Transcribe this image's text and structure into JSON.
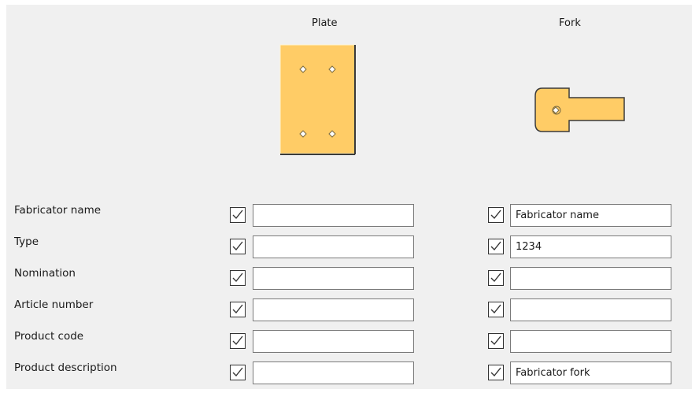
{
  "columns": {
    "plate": {
      "title": "Plate"
    },
    "fork": {
      "title": "Fork"
    }
  },
  "rows": [
    {
      "label": "Fabricator name",
      "plate": {
        "checked": true,
        "value": ""
      },
      "fork": {
        "checked": true,
        "value": "Fabricator name"
      }
    },
    {
      "label": "Type",
      "plate": {
        "checked": true,
        "value": ""
      },
      "fork": {
        "checked": true,
        "value": "1234"
      }
    },
    {
      "label": "Nomination",
      "plate": {
        "checked": true,
        "value": ""
      },
      "fork": {
        "checked": true,
        "value": ""
      }
    },
    {
      "label": "Article number",
      "plate": {
        "checked": true,
        "value": ""
      },
      "fork": {
        "checked": true,
        "value": ""
      }
    },
    {
      "label": "Product code",
      "plate": {
        "checked": true,
        "value": ""
      },
      "fork": {
        "checked": true,
        "value": ""
      }
    },
    {
      "label": "Product description",
      "plate": {
        "checked": true,
        "value": ""
      },
      "fork": {
        "checked": true,
        "value": "Fabricator fork"
      }
    }
  ],
  "colors": {
    "part_fill": "#ffcc66",
    "panel_bg": "#f0f0f0"
  },
  "icons": {
    "plate": "plate-preview-icon",
    "fork": "fork-preview-icon",
    "checkbox": "check-icon"
  }
}
